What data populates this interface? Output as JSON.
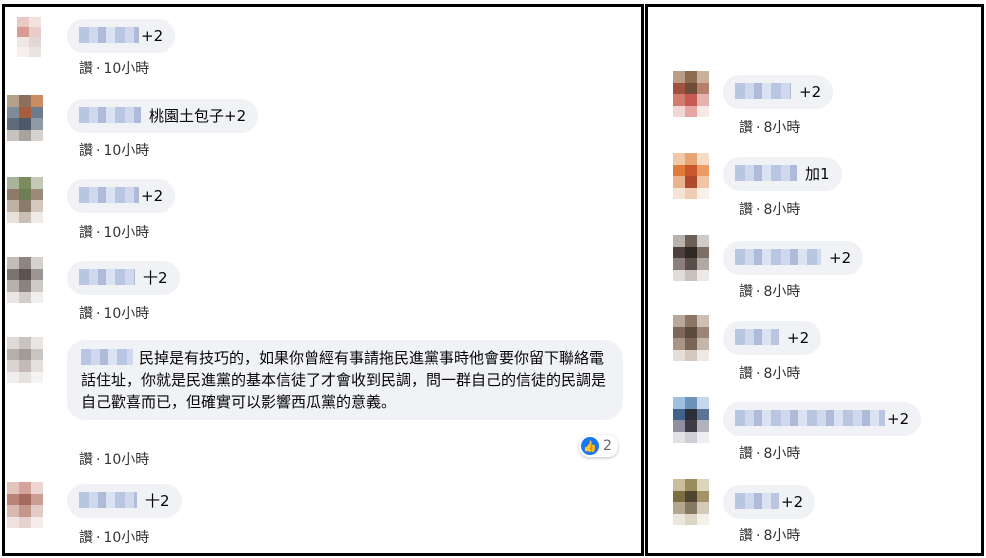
{
  "left_comments": [
    {
      "text": "+2",
      "like_label": "讚",
      "time": "10小時"
    },
    {
      "text": "桃園土包子+2",
      "like_label": "讚",
      "time": "10小時"
    },
    {
      "text": "+2",
      "like_label": "讚",
      "time": "10小時"
    },
    {
      "text": "十2",
      "like_label": "讚",
      "time": "10小時"
    },
    {
      "text": "民掉是有技巧的，如果你曾經有事請拖民進黨事時他會要你留下聯絡電話住址，你就是民進黨的基本信徒了才會收到民調，問一群自己的信徒的民調是自己歡喜而已，但確實可以影響西瓜黨的意義。",
      "like_label": "讚",
      "time": "10小時",
      "reaction_count": "2",
      "reaction_icon": "thumbs-up-icon"
    },
    {
      "text": "十2",
      "like_label": "讚",
      "time": "10小時"
    }
  ],
  "right_comments": [
    {
      "text": "+2",
      "like_label": "讚",
      "time": "8小時"
    },
    {
      "text": "加1",
      "like_label": "讚",
      "time": "8小時"
    },
    {
      "text": "+2",
      "like_label": "讚",
      "time": "8小時"
    },
    {
      "text": "+2",
      "like_label": "讚",
      "time": "8小時"
    },
    {
      "text": "+2",
      "like_label": "讚",
      "time": "8小時"
    },
    {
      "text": "+2",
      "like_label": "讚",
      "time": "8小時"
    }
  ],
  "separator": "·",
  "colors": {
    "bubble": "#f0f2f5",
    "like_blue": "#1877f2",
    "border": "#000000"
  }
}
